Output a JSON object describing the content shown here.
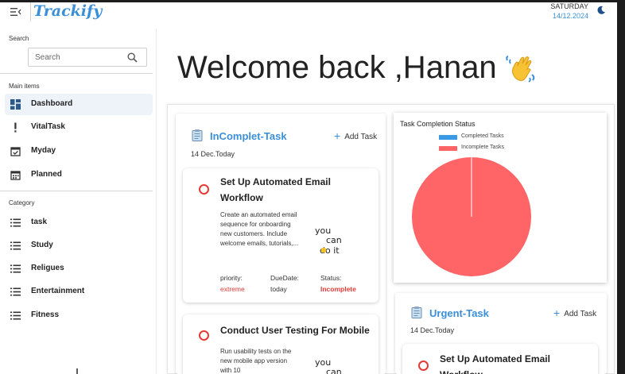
{
  "header": {
    "brand": "Trackify",
    "day": "SATURDAY",
    "date": "14/12.2024"
  },
  "sidebar": {
    "search_label": "Search",
    "search_placeholder": "Search",
    "main_items_label": "Main items",
    "main_items": [
      {
        "label": "Dashboard",
        "icon": "dashboard-icon",
        "active": true
      },
      {
        "label": "VitalTask",
        "icon": "exclamation-icon",
        "active": false
      },
      {
        "label": "Myday",
        "icon": "calendar-check-icon",
        "active": false
      },
      {
        "label": "Planned",
        "icon": "calendar-icon",
        "active": false
      }
    ],
    "category_label": "Category",
    "categories": [
      {
        "label": "task",
        "icon": "list-icon"
      },
      {
        "label": "Study",
        "icon": "list-icon"
      },
      {
        "label": "Religues",
        "icon": "list-icon"
      },
      {
        "label": "Entertainment",
        "icon": "list-icon"
      },
      {
        "label": "Fitness",
        "icon": "list-icon"
      }
    ]
  },
  "main": {
    "welcome": "Welcome back ,Hanan",
    "incomplete": {
      "title": "InComplet-Task",
      "add_label": "Add Task",
      "date": "14 Dec.Today",
      "cards": [
        {
          "title": "Set Up Automated Email Workflow",
          "description": "Create an automated email sequence for onboarding new customers. Include welcome emails, tutorials,...",
          "priority_label": "priority:",
          "priority": "extreme",
          "due_label": "DueDate:",
          "due": "today",
          "status_label": "Status:",
          "status": "Incomplete",
          "art_text": [
            "you",
            "can",
            "do it"
          ]
        },
        {
          "title": "Conduct User Testing For Mobile",
          "description": "Run usability tests on the new mobile app version with 10",
          "art_text": [
            "you",
            "can"
          ]
        }
      ]
    },
    "urgent": {
      "title": "Urgent-Task",
      "add_label": "Add Task",
      "date": "14 Dec.Today",
      "cards": [
        {
          "title": "Set Up Automated Email Workflow"
        }
      ]
    }
  },
  "colors": {
    "accent": "#3a8fd8",
    "danger": "#e53935",
    "completed": "#3a9ae6",
    "incomplete": "#ff6567"
  },
  "chart_data": {
    "type": "pie",
    "title": "Task Completion Status",
    "legend": [
      "Completed Tasks",
      "Incomplete Tasks"
    ],
    "legend_position": "top",
    "series": [
      {
        "name": "Completed Tasks",
        "value": 0,
        "color": "#3a9ae6"
      },
      {
        "name": "Incomplete Tasks",
        "value": 1,
        "color": "#ff6567"
      }
    ]
  }
}
